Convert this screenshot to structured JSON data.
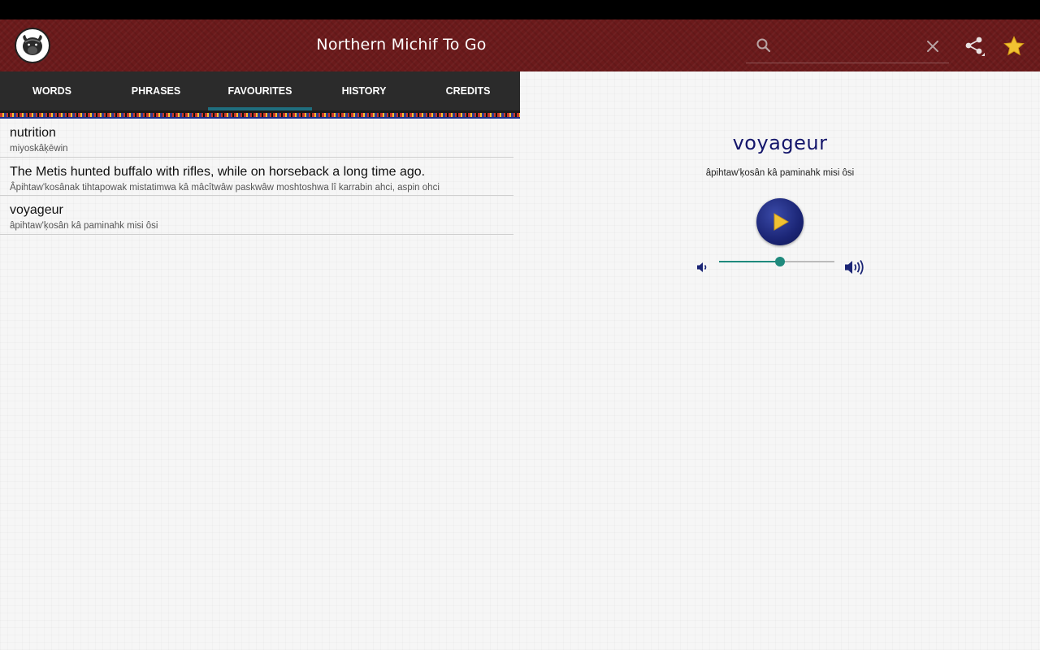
{
  "app_bar": {
    "title": "Northern Michif To Go",
    "search_placeholder": "",
    "icons": {
      "logo": "bison-logo-icon",
      "search": "search-icon",
      "clear": "close-icon",
      "share": "share-icon",
      "favourite": "star-icon"
    },
    "colors": {
      "bar": "#6b1a1b",
      "star": "#f1c232"
    }
  },
  "tabs": [
    {
      "label": "WORDS",
      "active": false
    },
    {
      "label": "PHRASES",
      "active": false
    },
    {
      "label": "FAVOURITES",
      "active": true
    },
    {
      "label": "HISTORY",
      "active": false
    },
    {
      "label": "CREDITS",
      "active": false
    }
  ],
  "favourites": [
    {
      "title": "nutrition",
      "subtitle": "miyoskâķēwin"
    },
    {
      "title": "The Metis hunted buffalo with rifles, while on horseback a long time ago.",
      "subtitle": "Âpihtaw'kosânak tihtapowak mistatimwa kâ mâcîtwâw paskwâw moshtoshwa lî karrabin ahci, aspin ohci"
    },
    {
      "title": "voyageur",
      "subtitle": "âpihtaw'ķosân kâ paminahk misi ôsi"
    }
  ],
  "detail": {
    "word": "voyageur",
    "translation": "âpihtaw'ķosân kâ paminahk misi ôsi",
    "volume_level": 0.53,
    "icons": {
      "play": "play-icon",
      "volume_low": "volume-low-icon",
      "volume_high": "volume-high-icon"
    },
    "colors": {
      "word": "#14166b",
      "slider": "#1f8a7d",
      "play_button": "#1b2575"
    }
  }
}
